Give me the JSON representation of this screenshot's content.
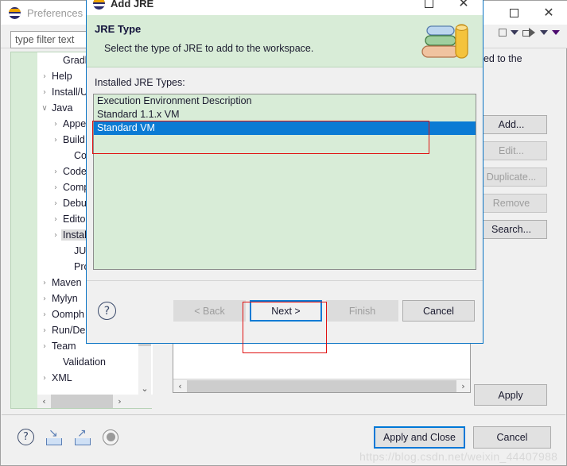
{
  "prefs_window": {
    "title": "Preferences",
    "icon": "eclipse-icon",
    "maximize_label": "maximize",
    "close_label": "close",
    "filter": {
      "placeholder": "type filter text",
      "value": ""
    },
    "tree": [
      {
        "label": "Gradle",
        "twisty": "",
        "selected": false,
        "indent": 1
      },
      {
        "label": "Help",
        "twisty": "›",
        "selected": false,
        "indent": 0
      },
      {
        "label": "Install/Upd",
        "twisty": "›",
        "selected": false,
        "indent": 0
      },
      {
        "label": "Java",
        "twisty": "∨",
        "selected": false,
        "indent": 0
      },
      {
        "label": "Appeara",
        "twisty": "›",
        "selected": false,
        "indent": 1
      },
      {
        "label": "Build Pat",
        "twisty": "›",
        "selected": false,
        "indent": 1
      },
      {
        "label": "Code Co",
        "twisty": "",
        "selected": false,
        "indent": 2
      },
      {
        "label": "Code Sty",
        "twisty": "›",
        "selected": false,
        "indent": 1
      },
      {
        "label": "Compile",
        "twisty": "›",
        "selected": false,
        "indent": 1
      },
      {
        "label": "Debug",
        "twisty": "›",
        "selected": false,
        "indent": 1
      },
      {
        "label": "Editor",
        "twisty": "›",
        "selected": false,
        "indent": 1
      },
      {
        "label": "Installed",
        "twisty": "›",
        "selected": true,
        "indent": 1
      },
      {
        "label": "JUnit",
        "twisty": "",
        "selected": false,
        "indent": 2
      },
      {
        "label": "Properti",
        "twisty": "",
        "selected": false,
        "indent": 2
      },
      {
        "label": "Maven",
        "twisty": "›",
        "selected": false,
        "indent": 0
      },
      {
        "label": "Mylyn",
        "twisty": "›",
        "selected": false,
        "indent": 0
      },
      {
        "label": "Oomph",
        "twisty": "›",
        "selected": false,
        "indent": 0
      },
      {
        "label": "Run/Debug",
        "twisty": "›",
        "selected": false,
        "indent": 0
      },
      {
        "label": "Team",
        "twisty": "›",
        "selected": false,
        "indent": 0
      },
      {
        "label": "Validation",
        "twisty": "",
        "selected": false,
        "indent": 1
      },
      {
        "label": "XML",
        "twisty": "›",
        "selected": false,
        "indent": 0
      }
    ],
    "pane": {
      "description_fragment": "ded to the",
      "side_buttons": [
        {
          "label": "Add...",
          "disabled": false
        },
        {
          "label": "Edit...",
          "disabled": true
        },
        {
          "label": "Duplicate...",
          "disabled": true
        },
        {
          "label": "Remove",
          "disabled": true
        },
        {
          "label": "Search...",
          "disabled": false
        }
      ],
      "apply_label": "Apply"
    },
    "footer": {
      "icons": [
        {
          "name": "help-icon",
          "glyph": "?"
        },
        {
          "name": "import-icon",
          "glyph": "↘"
        },
        {
          "name": "export-icon",
          "glyph": "↗"
        },
        {
          "name": "restore-defaults-icon",
          "glyph": ""
        }
      ],
      "apply_and_close_label": "Apply and Close",
      "cancel_label": "Cancel"
    },
    "watermark": "https://blog.csdn.net/weixin_44407988"
  },
  "dialog": {
    "title": "Add JRE",
    "banner": {
      "heading": "JRE Type",
      "subtext": "Select the type of JRE to add to the workspace.",
      "icon": "books-icon"
    },
    "list_label": "Installed JRE Types:",
    "list_items": [
      {
        "label": "Execution Environment Description",
        "selected": false
      },
      {
        "label": "Standard 1.1.x VM",
        "selected": false
      },
      {
        "label": "Standard VM",
        "selected": true
      }
    ],
    "help_glyph": "?",
    "buttons": [
      {
        "label": "< Back",
        "state": "disabled"
      },
      {
        "label": "Next >",
        "state": "focused"
      },
      {
        "label": "Finish",
        "state": "disabled"
      },
      {
        "label": "Cancel",
        "state": "normal"
      }
    ]
  },
  "annotations": {
    "accent_red": "#e01010",
    "accent_blue": "#0b7bd4",
    "banner_green": "#d8ecd7"
  }
}
